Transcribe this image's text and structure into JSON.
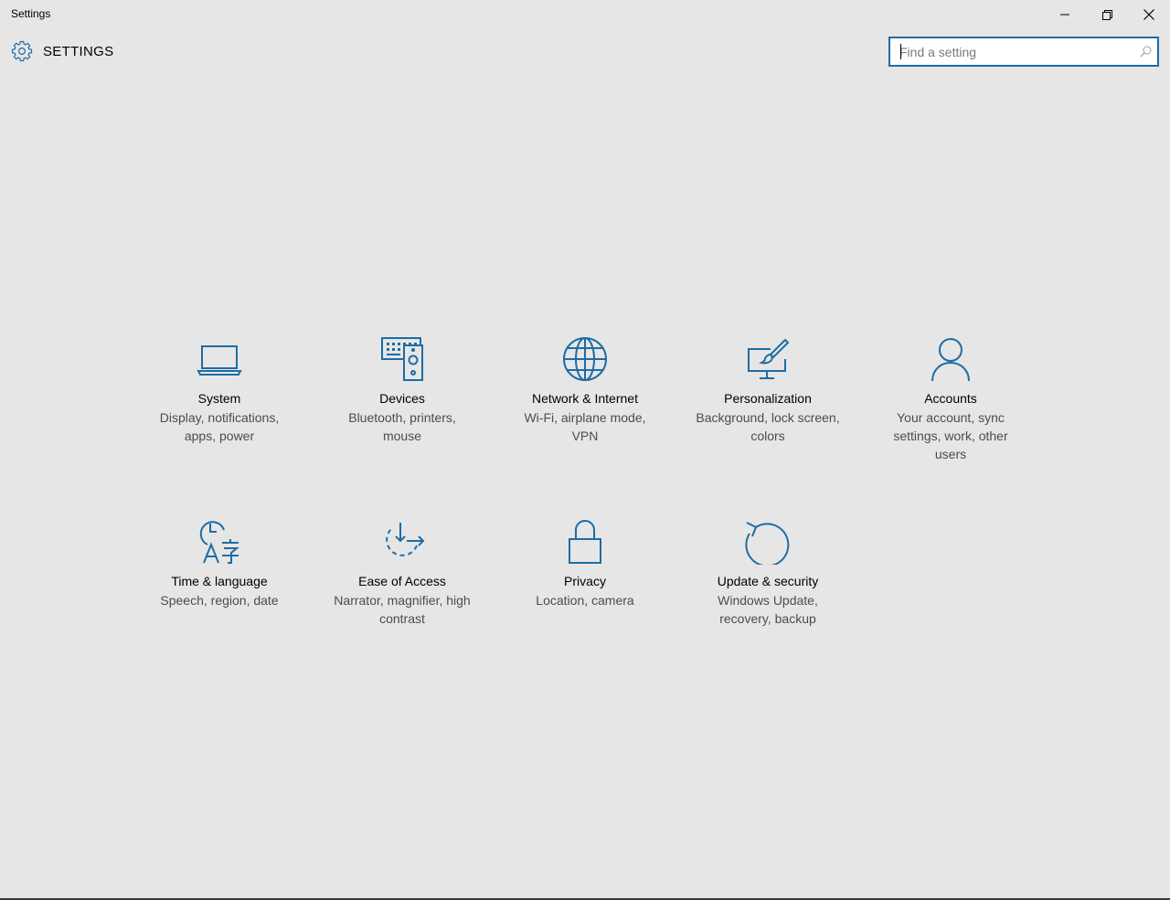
{
  "window": {
    "title": "Settings"
  },
  "header": {
    "title": "SETTINGS",
    "icon": "gear-icon"
  },
  "search": {
    "placeholder": "Find a setting",
    "value": ""
  },
  "colors": {
    "accent": "#1e6ca5",
    "background": "#e6e6e6"
  },
  "tiles": [
    {
      "label": "System",
      "description": "Display, notifications, apps, power",
      "icon": "laptop-icon"
    },
    {
      "label": "Devices",
      "description": "Bluetooth, printers, mouse",
      "icon": "devices-icon"
    },
    {
      "label": "Network & Internet",
      "description": "Wi-Fi, airplane mode, VPN",
      "icon": "globe-icon"
    },
    {
      "label": "Personalization",
      "description": "Background, lock screen, colors",
      "icon": "paintbrush-icon"
    },
    {
      "label": "Accounts",
      "description": "Your account, sync settings, work, other users",
      "icon": "person-icon"
    },
    {
      "label": "Time & language",
      "description": "Speech, region, date",
      "icon": "time-language-icon"
    },
    {
      "label": "Ease of Access",
      "description": "Narrator, magnifier, high contrast",
      "icon": "ease-of-access-icon"
    },
    {
      "label": "Privacy",
      "description": "Location, camera",
      "icon": "lock-icon"
    },
    {
      "label": "Update & security",
      "description": "Windows Update, recovery, backup",
      "icon": "update-icon"
    }
  ]
}
